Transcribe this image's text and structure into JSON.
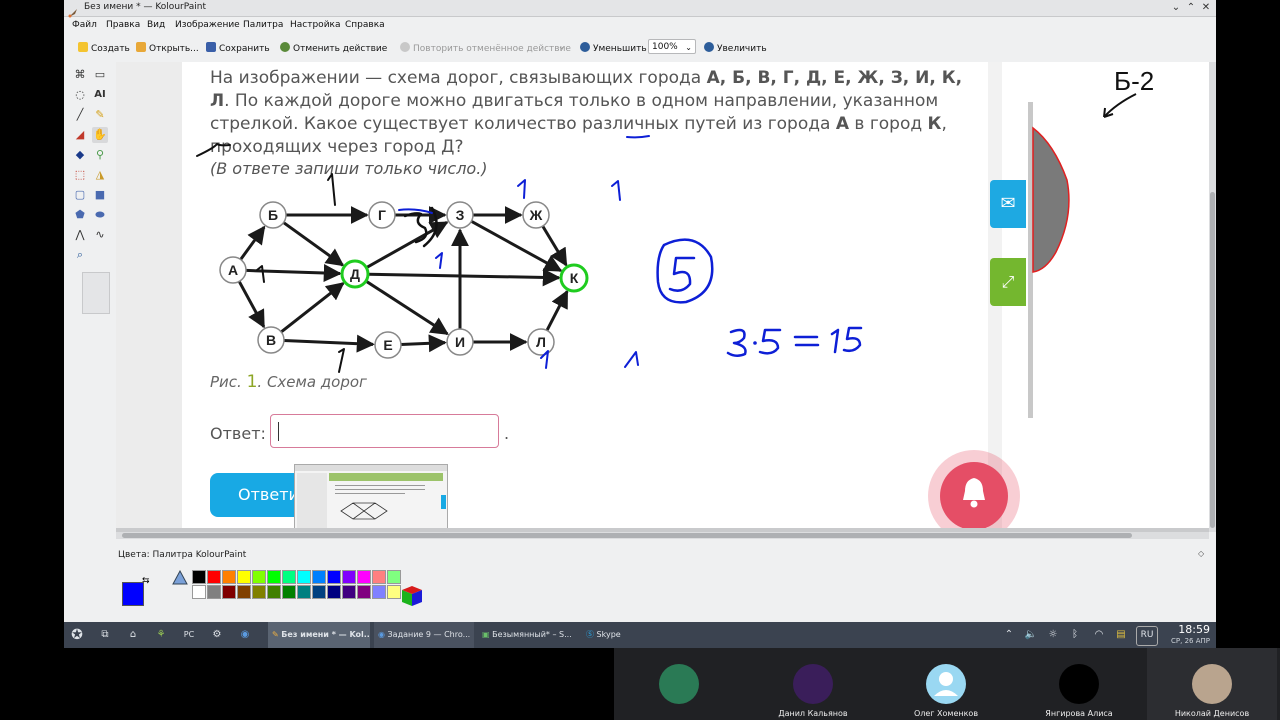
{
  "window": {
    "title": "Без имени * — KolourPaint",
    "menu": [
      "Файл",
      "Правка",
      "Вид",
      "Изображение",
      "Палитра",
      "Настройка",
      "Справка"
    ]
  },
  "toolbar": {
    "new": "Создать",
    "open": "Открыть...",
    "save": "Сохранить",
    "undo": "Отменить действие",
    "redo": "Повторить отменённое действие",
    "zoom_out": "Уменьшить",
    "zoom_value": "100%",
    "zoom_in": "Увеличить"
  },
  "task": {
    "text_parts": [
      "На изображении — схема дорог, связывающих города ",
      "А, Б, В, Г, Д, Е, Ж, З, И, К, Л",
      ". По каждой дороге можно двигаться только в одном направлении, указанном стрелкой. Какое существует количество различных путей из города ",
      "А",
      " в город ",
      "К",
      ", проходящих через город ",
      "Д",
      "?"
    ],
    "hint": "(В ответе запиши только число.)",
    "caption_prefix": "Рис. ",
    "caption_number": "1",
    "caption_suffix": ". Схема дорог",
    "answer_label": "Ответ:",
    "answer_value": "",
    "answer_dot": ".",
    "submit_label": "Ответить"
  },
  "graph": {
    "nodes": [
      "А",
      "Б",
      "В",
      "Г",
      "Д",
      "Е",
      "З",
      "Ж",
      "И",
      "Л",
      "К"
    ],
    "edges": [
      [
        "А",
        "Б"
      ],
      [
        "А",
        "Д"
      ],
      [
        "А",
        "В"
      ],
      [
        "Б",
        "Г"
      ],
      [
        "Б",
        "Д"
      ],
      [
        "В",
        "Д"
      ],
      [
        "В",
        "Е"
      ],
      [
        "Д",
        "З"
      ],
      [
        "Д",
        "И"
      ],
      [
        "Д",
        "К"
      ],
      [
        "Г",
        "З"
      ],
      [
        "З",
        "Ж"
      ],
      [
        "З",
        "К"
      ],
      [
        "Ж",
        "К"
      ],
      [
        "Е",
        "И"
      ],
      [
        "И",
        "З"
      ],
      [
        "И",
        "Л"
      ],
      [
        "Л",
        "К"
      ]
    ],
    "highlighted": [
      "Д",
      "К"
    ]
  },
  "handwriting": {
    "n_a": "1",
    "n_b": "1",
    "n_v": "1",
    "n_g": "3",
    "n_d": "1",
    "n_z": "1",
    "n_zh": "1",
    "n_i": "1",
    "n_l": "1",
    "n_k": "5",
    "calc": "3·5 = 15",
    "side_label": "Б-2"
  },
  "colors": {
    "ink_blue": "#0d1fd6",
    "ink_black": "#111111",
    "highlight_green": "#1fcc1f",
    "accent_blue": "#18a9e4",
    "accent_green": "#74b72f",
    "notify_red": "#e54e66",
    "input_border": "#d77b9a"
  },
  "palette": {
    "title": "Цвета: Палитра KolourPaint",
    "swatches": [
      [
        "#000000",
        "#ff0000",
        "#ff8000",
        "#ffff00",
        "#80ff00",
        "#00ff00",
        "#00ff80",
        "#00ffff",
        "#0080ff",
        "#0000ff",
        "#8000ff",
        "#ff00ff",
        "#ff8080",
        "#80ff80"
      ],
      [
        "#ffffff",
        "#808080",
        "#800000",
        "#804000",
        "#808000",
        "#408000",
        "#008000",
        "#008080",
        "#004080",
        "#000080",
        "#400080",
        "#800080",
        "#8080ff",
        "#ffff80"
      ]
    ]
  },
  "taskbar": {
    "tasks": [
      "Без имени * — Kol...",
      "Задание 9 — Chro...",
      "Безымянный* – S...",
      "Skype"
    ],
    "lang": "RU",
    "time": "18:59",
    "date": "СР, 26 АПР"
  },
  "call": {
    "participants": [
      {
        "name": "",
        "avatar_color": "#2a7a55"
      },
      {
        "name": "Данил Кальянов",
        "avatar_color": "#3a1e5a"
      },
      {
        "name": "Олег Хоменков",
        "avatar_color": "#7fd0f0"
      },
      {
        "name": "Янгирова Алиса",
        "avatar_color": "#000000"
      },
      {
        "name": "Николай Денисов",
        "avatar_color": "#b9a48e"
      }
    ]
  }
}
